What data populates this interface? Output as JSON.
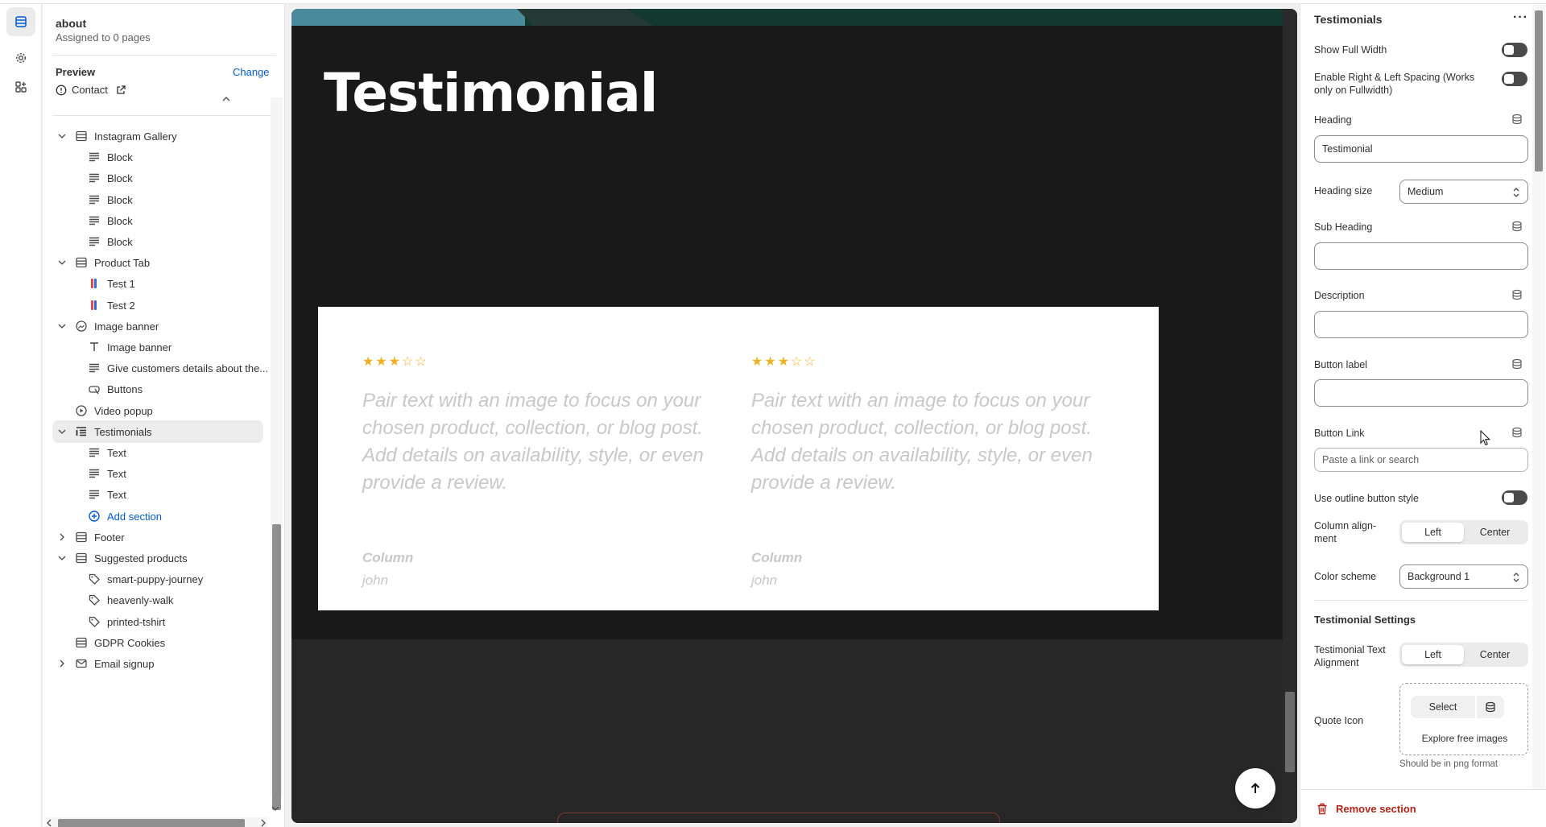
{
  "template": {
    "name": "about",
    "assigned": "Assigned to 0 pages"
  },
  "preview": {
    "label": "Preview",
    "change": "Change",
    "page": "Contact"
  },
  "tree": [
    {
      "label": "Instagram Gallery",
      "level": 0,
      "icon": "section-icon",
      "chevron": "down"
    },
    {
      "label": "Block",
      "level": 1,
      "icon": "text-block-icon"
    },
    {
      "label": "Block",
      "level": 1,
      "icon": "text-block-icon"
    },
    {
      "label": "Block",
      "level": 1,
      "icon": "text-block-icon"
    },
    {
      "label": "Block",
      "level": 1,
      "icon": "text-block-icon"
    },
    {
      "label": "Block",
      "level": 1,
      "icon": "text-block-icon"
    },
    {
      "label": "Product Tab",
      "level": 0,
      "icon": "section-icon",
      "chevron": "down"
    },
    {
      "label": "Test 1",
      "level": 1,
      "icon": "color-swatch-icon"
    },
    {
      "label": "Test 2",
      "level": 1,
      "icon": "color-swatch-icon"
    },
    {
      "label": "Image banner",
      "level": 0,
      "icon": "image-icon",
      "chevron": "down"
    },
    {
      "label": "Image banner",
      "level": 1,
      "icon": "heading-icon"
    },
    {
      "label": "Give customers details about the...",
      "level": 1,
      "icon": "text-block-icon"
    },
    {
      "label": "Buttons",
      "level": 1,
      "icon": "button-icon"
    },
    {
      "label": "Video popup",
      "level": 0,
      "icon": "play-icon"
    },
    {
      "label": "Testimonials",
      "level": 0,
      "icon": "list-section-icon",
      "chevron": "down",
      "selected": true
    },
    {
      "label": "Text",
      "level": 1,
      "icon": "text-block-icon"
    },
    {
      "label": "Text",
      "level": 1,
      "icon": "text-block-icon"
    },
    {
      "label": "Text",
      "level": 1,
      "icon": "text-block-icon"
    },
    {
      "label": "Add section",
      "level": 1,
      "icon": "plus-circle-icon",
      "add": true
    },
    {
      "label": "Footer",
      "level": 0,
      "icon": "section-icon",
      "chevron": "right"
    },
    {
      "label": "Suggested products",
      "level": 0,
      "icon": "section-icon",
      "chevron": "down"
    },
    {
      "label": "smart-puppy-journey",
      "level": 1,
      "icon": "tag-icon"
    },
    {
      "label": "heavenly-walk",
      "level": 1,
      "icon": "tag-icon"
    },
    {
      "label": "printed-tshirt",
      "level": 1,
      "icon": "tag-icon"
    },
    {
      "label": "GDPR Cookies",
      "level": 0,
      "icon": "section-icon"
    },
    {
      "label": "Email signup",
      "level": 0,
      "icon": "mail-icon",
      "chevron": "right"
    }
  ],
  "canvas": {
    "heading": "Testimonial",
    "cards": [
      {
        "rating": 3,
        "max": 5,
        "text": "Pair text with an image to focus on your chosen product, collection, or blog post. Add details on availability, style, or even provide a review.",
        "name": "Column",
        "role": "john"
      },
      {
        "rating": 3,
        "max": 5,
        "text": "Pair text with an image to focus on your chosen product, collection, or blog post. Add details on availability, style, or even provide a review.",
        "name": "Column",
        "role": "john"
      }
    ]
  },
  "settings": {
    "title": "Testimonials",
    "more": "···",
    "show_full_width": "Show Full Width",
    "enable_spacing": "Enable Right & Left Spacing (Works only on Fullwidth)",
    "heading_label": "Heading",
    "heading_value": "Testimonial",
    "heading_size_label": "Heading size",
    "heading_size_value": "Medium",
    "sub_heading_label": "Sub Heading",
    "description_label": "Description",
    "button_label_label": "Button label",
    "button_link_label": "Button Link",
    "button_link_placeholder": "Paste a link or search",
    "outline_label": "Use outline button style",
    "column_alignment_label": "Column align-\nment",
    "column_alignment_options": [
      "Left",
      "Center"
    ],
    "color_scheme_label": "Color scheme",
    "color_scheme_value": "Background 1",
    "testimonial_settings": "Testimonial Settings",
    "text_alignment_label": "Testimonial Text Alignment",
    "text_alignment_options": [
      "Left",
      "Center"
    ],
    "quote_icon_label": "Quote Icon",
    "select": "Select",
    "explore": "Explore free images",
    "hint": "Should be in png format",
    "remove": "Remove section"
  },
  "colors": {
    "accent_link": "#005bd3",
    "danger": "#b42318",
    "star": "#f2b01e"
  }
}
